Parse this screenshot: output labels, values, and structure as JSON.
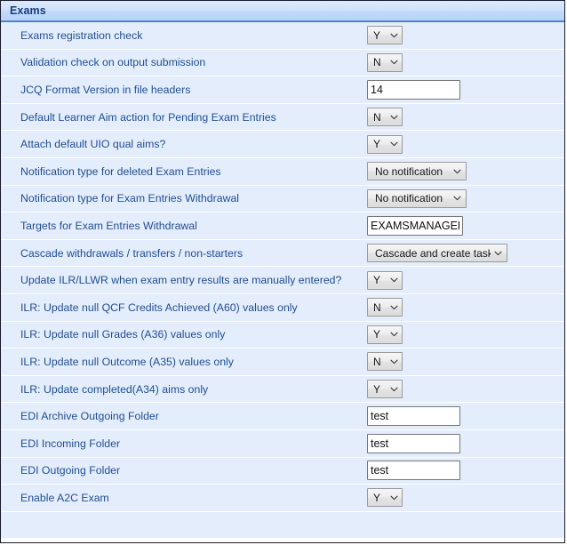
{
  "panel": {
    "title": "Exams",
    "accent_color": "#1f4e96",
    "header_border_color": "#4f85c8",
    "row_background": "#e4edfb",
    "label_color": "#1f4e96"
  },
  "rows": [
    {
      "label": "Exams registration check",
      "control": "select",
      "size": "small",
      "value": "Y"
    },
    {
      "label": "Validation check on output submission",
      "control": "select",
      "size": "small",
      "value": "N"
    },
    {
      "label": "JCQ Format Version in file headers",
      "control": "input",
      "size": "w-std",
      "value": "14"
    },
    {
      "label": "Default Learner Aim action for Pending Exam Entries",
      "control": "select",
      "size": "small",
      "value": "N"
    },
    {
      "label": "Attach default UIO qual aims?",
      "control": "select",
      "size": "small",
      "value": "Y"
    },
    {
      "label": "Notification type for deleted Exam Entries",
      "control": "select",
      "size": "medium",
      "value": "No notification"
    },
    {
      "label": "Notification type for Exam Entries Withdrawal",
      "control": "select",
      "size": "medium",
      "value": "No notification"
    },
    {
      "label": "Targets for Exam Entries Withdrawal",
      "control": "input",
      "size": "w-tight",
      "value": "EXAMSMANAGER"
    },
    {
      "label": "Cascade withdrawals / transfers / non-starters",
      "control": "select",
      "size": "wide",
      "value": "Cascade and create task"
    },
    {
      "label": "Update ILR/LLWR when exam entry results are manually entered?",
      "control": "select",
      "size": "small",
      "value": "Y"
    },
    {
      "label": "ILR: Update null QCF Credits Achieved (A60) values only",
      "control": "select",
      "size": "small",
      "value": "N"
    },
    {
      "label": "ILR: Update null Grades (A36) values only",
      "control": "select",
      "size": "small",
      "value": "Y"
    },
    {
      "label": "ILR: Update null Outcome (A35) values only",
      "control": "select",
      "size": "small",
      "value": "N"
    },
    {
      "label": "ILR: Update completed(A34) aims only",
      "control": "select",
      "size": "small",
      "value": "Y"
    },
    {
      "label": "EDI Archive Outgoing Folder",
      "control": "input",
      "size": "w-std",
      "value": "test"
    },
    {
      "label": "EDI Incoming Folder",
      "control": "input",
      "size": "w-std",
      "value": "test"
    },
    {
      "label": "EDI Outgoing Folder",
      "control": "input",
      "size": "w-std",
      "value": "test"
    },
    {
      "label": "Enable A2C Exam",
      "control": "select",
      "size": "small",
      "value": "Y"
    },
    {
      "label": "",
      "control": "none",
      "size": "",
      "value": ""
    }
  ]
}
